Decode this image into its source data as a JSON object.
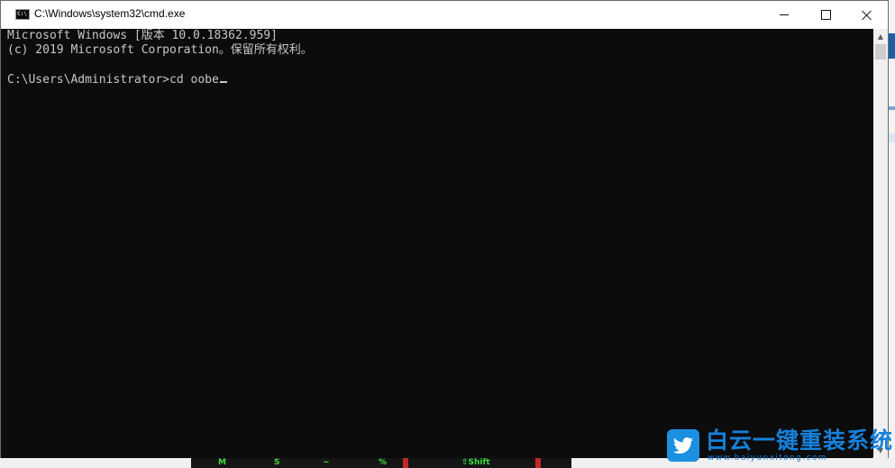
{
  "window": {
    "title": "C:\\Windows\\system32\\cmd.exe",
    "icon_label": "C:\\",
    "minimize_glyph": "—",
    "maximize_glyph": "☐",
    "close_glyph": "✕"
  },
  "console": {
    "line1": "Microsoft Windows [版本 10.0.18362.959]",
    "line2": "(c) 2019 Microsoft Corporation。保留所有权利。",
    "prompt": "C:\\Users\\Administrator>",
    "command": "cd oobe"
  },
  "scrollbar": {
    "up_glyph": "▲",
    "down_glyph": "▼"
  },
  "background": {
    "game_keys": [
      "M",
      "S",
      "~",
      "%",
      "⇧Shift"
    ]
  },
  "watermark": {
    "title": "白云一键重装系统",
    "url": "www.baiyunxitong.com",
    "icon": "twitter-bird-icon"
  },
  "colors": {
    "console_bg": "#0c0c0c",
    "console_text": "#c7c7c7",
    "watermark_blue": "#1680d8"
  }
}
